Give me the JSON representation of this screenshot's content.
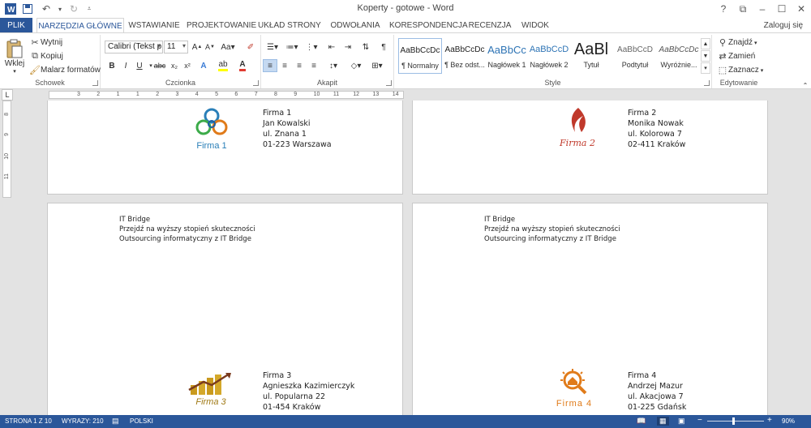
{
  "window": {
    "title": "Koperty - gotowe - Word",
    "controls": [
      "?",
      "⧉",
      "–",
      "☐",
      "✕"
    ]
  },
  "tabs": {
    "file": "PLIK",
    "items": [
      "NARZĘDZIA GŁÓWNE",
      "WSTAWIANIE",
      "PROJEKTOWANIE",
      "UKŁAD STRONY",
      "ODWOŁANIA",
      "KORESPONDENCJA",
      "RECENZJA",
      "WIDOK"
    ],
    "active": "NARZĘDZIA GŁÓWNE",
    "login": "Zaloguj się"
  },
  "ribbon": {
    "clipboard": {
      "label": "Schowek",
      "paste": "Wklej",
      "cut": "Wytnij",
      "copy": "Kopiuj",
      "format_painter": "Malarz formatów"
    },
    "font": {
      "label": "Czcionka",
      "font_name": "Calibri (Tekst p",
      "font_size": "11"
    },
    "paragraph": {
      "label": "Akapit"
    },
    "styles": {
      "label": "Style",
      "items": [
        {
          "preview": "AaBbCcDc",
          "name": "¶ Normalny"
        },
        {
          "preview": "AaBbCcDc",
          "name": "¶ Bez odst..."
        },
        {
          "preview": "AaBbCc",
          "name": "Nagłówek 1"
        },
        {
          "preview": "AaBbCcD",
          "name": "Nagłówek 2"
        },
        {
          "preview": "AaBl",
          "name": "Tytuł"
        },
        {
          "preview": "AaBbCcD",
          "name": "Podtytuł"
        },
        {
          "preview": "AaBbCcDc",
          "name": "Wyróżnie..."
        }
      ]
    },
    "editing": {
      "label": "Edytowanie",
      "find": "Znajdź",
      "replace": "Zamień",
      "select": "Zaznacz"
    }
  },
  "ruler": {
    "marks": [
      "3",
      "2",
      "1",
      "1",
      "2",
      "3",
      "4",
      "5",
      "6",
      "7",
      "8",
      "9",
      "10",
      "11",
      "12",
      "13",
      "14"
    ],
    "vmarks": [
      "8",
      "9",
      "10",
      "11"
    ]
  },
  "envelopes": [
    {
      "logo_text": "Firma 1",
      "logo_color": "#2a7fb8",
      "recipient": [
        "Firma 1",
        "Jan Kowalski",
        "ul. Znana 1",
        "01-223  Warszawa"
      ]
    },
    {
      "logo_text": "Firma 2",
      "logo_color": "#c0392b",
      "recipient": [
        "Firma 2",
        "Monika Nowak",
        "ul. Kolorowa 7",
        "02-411  Kraków"
      ]
    },
    {
      "sender": [
        "IT Bridge",
        "Przejdź na wyższy stopień skuteczności",
        "Outsourcing informatyczny z IT Bridge"
      ],
      "logo_text": "Firma 3",
      "logo_color": "#c99a1e",
      "recipient": [
        "Firma 3",
        "Agnieszka Kazimierczyk",
        "ul. Popularna 22",
        "01-454  Kraków"
      ]
    },
    {
      "sender": [
        "IT Bridge",
        "Przejdź na wyższy stopień skuteczności",
        "Outsourcing informatyczny z IT Bridge"
      ],
      "logo_text": "Firma 4",
      "logo_color": "#e07b1a",
      "recipient": [
        "Firma 4",
        "Andrzej Mazur",
        "ul. Akacjowa 7",
        "01-225  Gdańsk"
      ]
    }
  ],
  "status": {
    "page": "STRONA 1 Z 10",
    "words": "WYRAZY: 210",
    "language": "POLSKI",
    "zoom": "90%",
    "zoom_level": 0.45
  },
  "colors": {
    "accent": "#2b579a"
  }
}
